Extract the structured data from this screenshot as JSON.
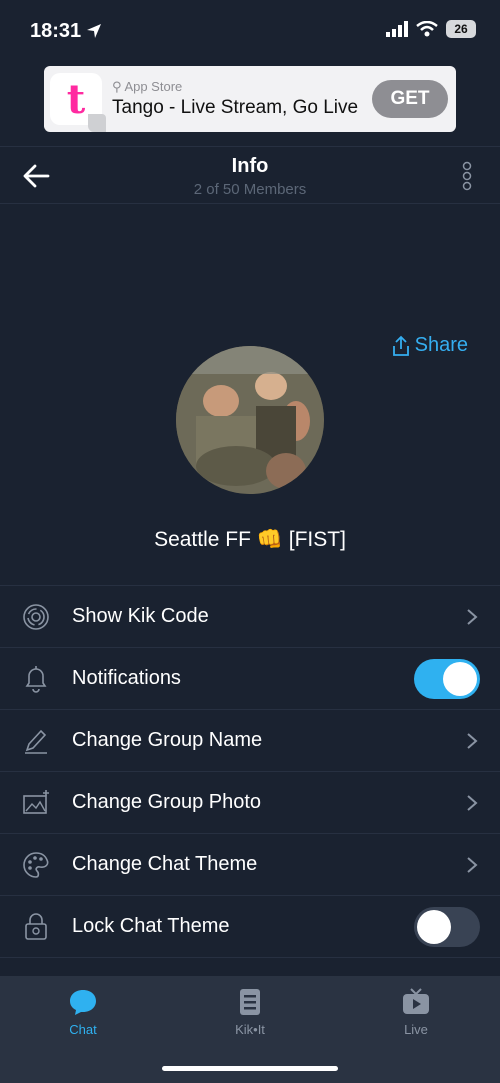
{
  "status": {
    "time": "18:31",
    "battery": "26"
  },
  "ad": {
    "store": "App Store",
    "title": "Tango - Live Stream, Go Live",
    "button": "GET",
    "logo_letter": "t"
  },
  "header": {
    "title": "Info",
    "subtitle": "2 of 50 Members"
  },
  "share_label": "Share",
  "group_name": "Seattle FF 👊 [FIST]",
  "menu": [
    {
      "label": "Show Kik Code",
      "icon": "kik-code-icon"
    },
    {
      "label": "Notifications",
      "icon": "bell-icon",
      "toggle": true
    },
    {
      "label": "Change Group Name",
      "icon": "pencil-icon"
    },
    {
      "label": "Change Group Photo",
      "icon": "photo-icon"
    },
    {
      "label": "Change Chat Theme",
      "icon": "palette-icon"
    },
    {
      "label": "Lock Chat Theme",
      "icon": "lock-palette-icon",
      "toggle": false
    }
  ],
  "tabs": [
    {
      "label": "Chat",
      "icon": "chat-bubble-icon",
      "active": true
    },
    {
      "label": "Kik•It",
      "icon": "kikit-icon",
      "active": false
    },
    {
      "label": "Live",
      "icon": "live-tv-icon",
      "active": false
    }
  ],
  "colors": {
    "accent": "#2fb1f0",
    "background": "#1a2230",
    "tabbar": "#2a3342"
  }
}
